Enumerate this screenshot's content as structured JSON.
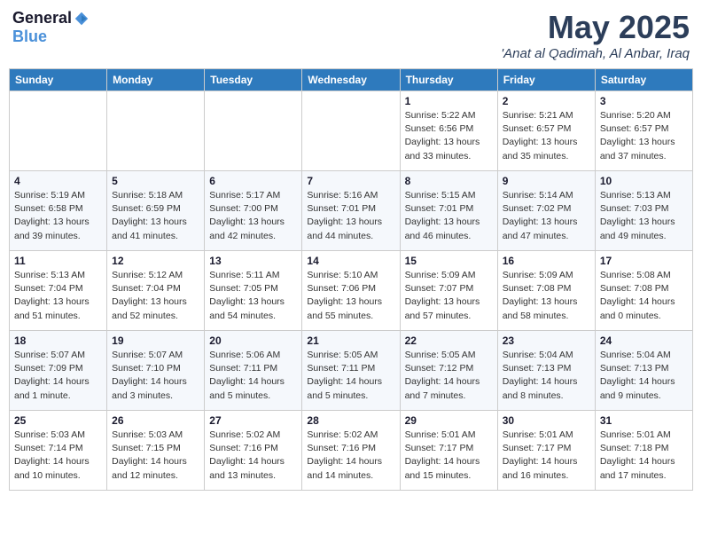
{
  "header": {
    "logo_general": "General",
    "logo_blue": "Blue",
    "month_title": "May 2025",
    "location": "'Anat al Qadimah, Al Anbar, Iraq"
  },
  "days_of_week": [
    "Sunday",
    "Monday",
    "Tuesday",
    "Wednesday",
    "Thursday",
    "Friday",
    "Saturday"
  ],
  "weeks": [
    [
      {
        "day": "",
        "detail": ""
      },
      {
        "day": "",
        "detail": ""
      },
      {
        "day": "",
        "detail": ""
      },
      {
        "day": "",
        "detail": ""
      },
      {
        "day": "1",
        "detail": "Sunrise: 5:22 AM\nSunset: 6:56 PM\nDaylight: 13 hours\nand 33 minutes."
      },
      {
        "day": "2",
        "detail": "Sunrise: 5:21 AM\nSunset: 6:57 PM\nDaylight: 13 hours\nand 35 minutes."
      },
      {
        "day": "3",
        "detail": "Sunrise: 5:20 AM\nSunset: 6:57 PM\nDaylight: 13 hours\nand 37 minutes."
      }
    ],
    [
      {
        "day": "4",
        "detail": "Sunrise: 5:19 AM\nSunset: 6:58 PM\nDaylight: 13 hours\nand 39 minutes."
      },
      {
        "day": "5",
        "detail": "Sunrise: 5:18 AM\nSunset: 6:59 PM\nDaylight: 13 hours\nand 41 minutes."
      },
      {
        "day": "6",
        "detail": "Sunrise: 5:17 AM\nSunset: 7:00 PM\nDaylight: 13 hours\nand 42 minutes."
      },
      {
        "day": "7",
        "detail": "Sunrise: 5:16 AM\nSunset: 7:01 PM\nDaylight: 13 hours\nand 44 minutes."
      },
      {
        "day": "8",
        "detail": "Sunrise: 5:15 AM\nSunset: 7:01 PM\nDaylight: 13 hours\nand 46 minutes."
      },
      {
        "day": "9",
        "detail": "Sunrise: 5:14 AM\nSunset: 7:02 PM\nDaylight: 13 hours\nand 47 minutes."
      },
      {
        "day": "10",
        "detail": "Sunrise: 5:13 AM\nSunset: 7:03 PM\nDaylight: 13 hours\nand 49 minutes."
      }
    ],
    [
      {
        "day": "11",
        "detail": "Sunrise: 5:13 AM\nSunset: 7:04 PM\nDaylight: 13 hours\nand 51 minutes."
      },
      {
        "day": "12",
        "detail": "Sunrise: 5:12 AM\nSunset: 7:04 PM\nDaylight: 13 hours\nand 52 minutes."
      },
      {
        "day": "13",
        "detail": "Sunrise: 5:11 AM\nSunset: 7:05 PM\nDaylight: 13 hours\nand 54 minutes."
      },
      {
        "day": "14",
        "detail": "Sunrise: 5:10 AM\nSunset: 7:06 PM\nDaylight: 13 hours\nand 55 minutes."
      },
      {
        "day": "15",
        "detail": "Sunrise: 5:09 AM\nSunset: 7:07 PM\nDaylight: 13 hours\nand 57 minutes."
      },
      {
        "day": "16",
        "detail": "Sunrise: 5:09 AM\nSunset: 7:08 PM\nDaylight: 13 hours\nand 58 minutes."
      },
      {
        "day": "17",
        "detail": "Sunrise: 5:08 AM\nSunset: 7:08 PM\nDaylight: 14 hours\nand 0 minutes."
      }
    ],
    [
      {
        "day": "18",
        "detail": "Sunrise: 5:07 AM\nSunset: 7:09 PM\nDaylight: 14 hours\nand 1 minute."
      },
      {
        "day": "19",
        "detail": "Sunrise: 5:07 AM\nSunset: 7:10 PM\nDaylight: 14 hours\nand 3 minutes."
      },
      {
        "day": "20",
        "detail": "Sunrise: 5:06 AM\nSunset: 7:11 PM\nDaylight: 14 hours\nand 5 minutes."
      },
      {
        "day": "21",
        "detail": "Sunrise: 5:05 AM\nSunset: 7:11 PM\nDaylight: 14 hours\nand 5 minutes."
      },
      {
        "day": "22",
        "detail": "Sunrise: 5:05 AM\nSunset: 7:12 PM\nDaylight: 14 hours\nand 7 minutes."
      },
      {
        "day": "23",
        "detail": "Sunrise: 5:04 AM\nSunset: 7:13 PM\nDaylight: 14 hours\nand 8 minutes."
      },
      {
        "day": "24",
        "detail": "Sunrise: 5:04 AM\nSunset: 7:13 PM\nDaylight: 14 hours\nand 9 minutes."
      }
    ],
    [
      {
        "day": "25",
        "detail": "Sunrise: 5:03 AM\nSunset: 7:14 PM\nDaylight: 14 hours\nand 10 minutes."
      },
      {
        "day": "26",
        "detail": "Sunrise: 5:03 AM\nSunset: 7:15 PM\nDaylight: 14 hours\nand 12 minutes."
      },
      {
        "day": "27",
        "detail": "Sunrise: 5:02 AM\nSunset: 7:16 PM\nDaylight: 14 hours\nand 13 minutes."
      },
      {
        "day": "28",
        "detail": "Sunrise: 5:02 AM\nSunset: 7:16 PM\nDaylight: 14 hours\nand 14 minutes."
      },
      {
        "day": "29",
        "detail": "Sunrise: 5:01 AM\nSunset: 7:17 PM\nDaylight: 14 hours\nand 15 minutes."
      },
      {
        "day": "30",
        "detail": "Sunrise: 5:01 AM\nSunset: 7:17 PM\nDaylight: 14 hours\nand 16 minutes."
      },
      {
        "day": "31",
        "detail": "Sunrise: 5:01 AM\nSunset: 7:18 PM\nDaylight: 14 hours\nand 17 minutes."
      }
    ]
  ]
}
